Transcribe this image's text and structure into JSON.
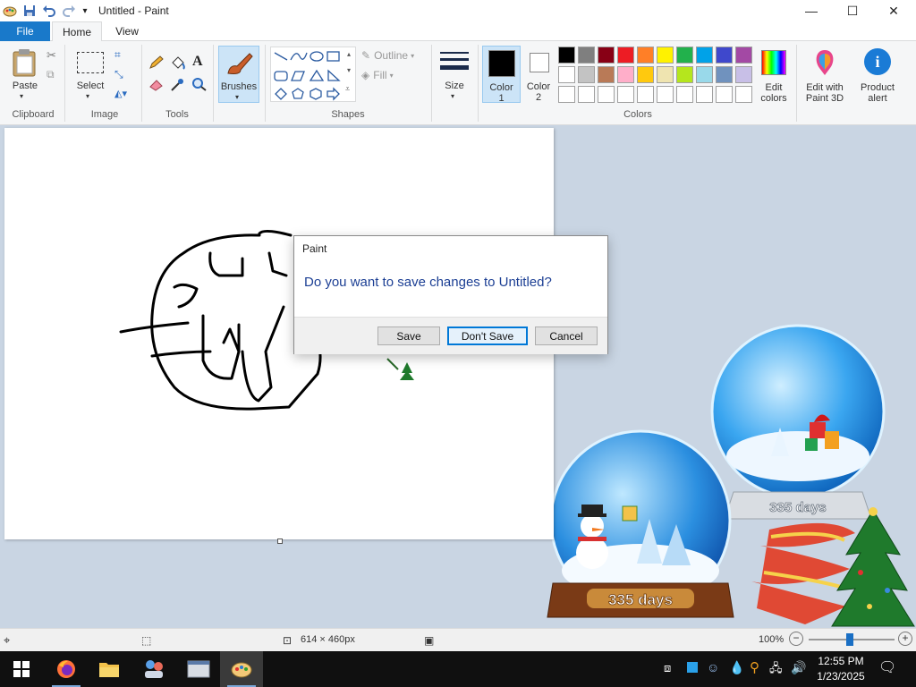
{
  "window": {
    "title": "Untitled - Paint",
    "minimize": "—",
    "maximize": "☐",
    "close": "✕"
  },
  "tabs": [
    "File",
    "Home",
    "View"
  ],
  "ribbon": {
    "clipboard": {
      "label": "Clipboard",
      "paste": "Paste"
    },
    "image": {
      "label": "Image",
      "select": "Select"
    },
    "tools": {
      "label": "Tools",
      "text_tool": "A"
    },
    "brushes": "Brushes",
    "shapes": {
      "label": "Shapes",
      "outline": "Outline",
      "fill": "Fill"
    },
    "size": "Size",
    "color1": {
      "line1": "Color",
      "line2": "1"
    },
    "color2": {
      "line1": "Color",
      "line2": "2"
    },
    "colors_label": "Colors",
    "edit_colors": {
      "line1": "Edit",
      "line2": "colors"
    },
    "paint3d": {
      "line1": "Edit with",
      "line2": "Paint 3D"
    },
    "product_alert": {
      "line1": "Product",
      "line2": "alert"
    },
    "palette_row1": [
      "#000000",
      "#7f7f7f",
      "#880015",
      "#ed1c24",
      "#ff7f27",
      "#fff200",
      "#22b14c",
      "#00a2e8",
      "#3f48cc",
      "#a349a4"
    ],
    "palette_row2": [
      "#ffffff",
      "#c3c3c3",
      "#b97a57",
      "#ffaec9",
      "#ffc90e",
      "#efe4b0",
      "#b5e61d",
      "#99d9ea",
      "#7092be",
      "#c8bfe7"
    ],
    "palette_row3": [
      "#ffffff",
      "#ffffff",
      "#ffffff",
      "#ffffff",
      "#ffffff",
      "#ffffff",
      "#ffffff",
      "#ffffff",
      "#ffffff",
      "#ffffff"
    ]
  },
  "dialog": {
    "title": "Paint",
    "message": "Do you want to save changes to Untitled?",
    "save": "Save",
    "dont_save": "Don't Save",
    "cancel": "Cancel"
  },
  "status": {
    "dimensions": "614 × 460px",
    "zoom": "100%"
  },
  "wallpaper": {
    "globe1_text": "335 days",
    "globe2_text": "335 days"
  },
  "taskbar": {
    "time": "12:55 PM",
    "date": "1/23/2025"
  }
}
